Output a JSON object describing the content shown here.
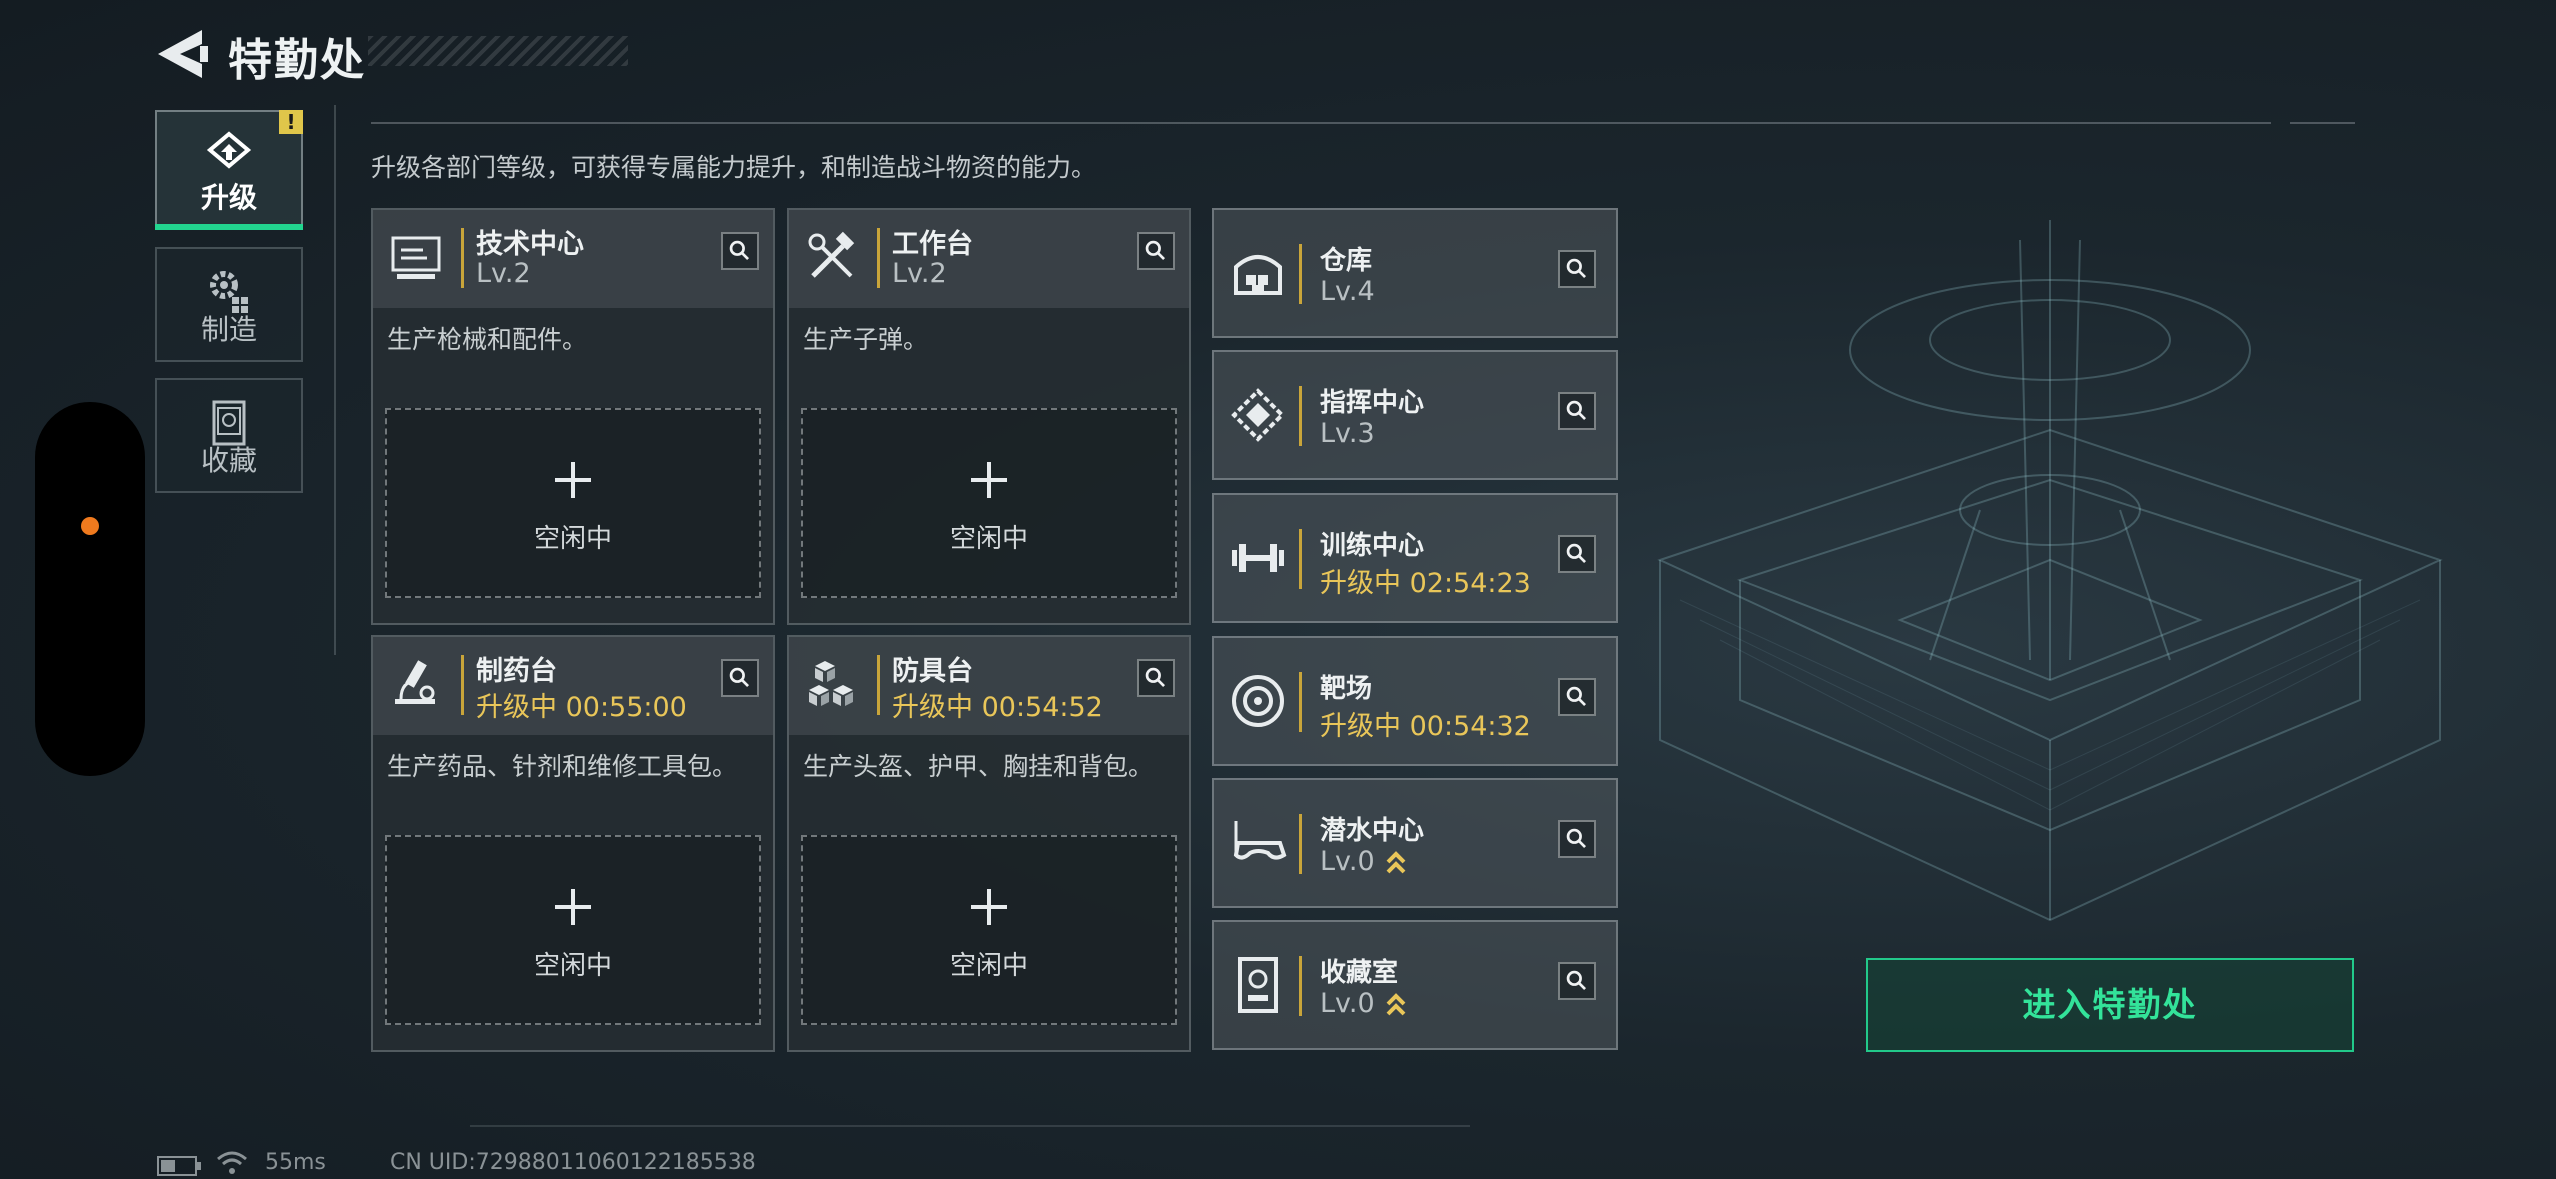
{
  "header": {
    "title": "特勤处"
  },
  "sidebar": {
    "tabs": [
      {
        "label": "升级",
        "icon": "upgrade-icon",
        "active": true,
        "alert": "!"
      },
      {
        "label": "制造",
        "icon": "gears-icon",
        "active": false
      },
      {
        "label": "收藏",
        "icon": "collection-icon",
        "active": false
      }
    ]
  },
  "description": "升级各部门等级，可获得专属能力提升，和制造战斗物资的能力。",
  "facilities": [
    {
      "name": "技术中心",
      "level": "Lv.2",
      "desc": "生产枪械和配件。",
      "slot": "空闲中",
      "icon": "tech-monitor-icon"
    },
    {
      "name": "工作台",
      "level": "Lv.2",
      "desc": "生产子弹。",
      "slot": "空闲中",
      "icon": "tools-icon"
    },
    {
      "name": "制药台",
      "level": "升级中 00:55:00",
      "desc": "生产药品、针剂和维修工具包。",
      "slot": "空闲中",
      "icon": "microscope-icon"
    },
    {
      "name": "防具台",
      "level": "升级中 00:54:52",
      "desc": "生产头盔、护甲、胸挂和背包。",
      "slot": "空闲中",
      "icon": "armor-blocks-icon"
    }
  ],
  "departments": [
    {
      "name": "仓库",
      "level": "Lv.4",
      "icon": "warehouse-icon"
    },
    {
      "name": "指挥中心",
      "level": "Lv.3",
      "icon": "command-chip-icon"
    },
    {
      "name": "训练中心",
      "level": "升级中 02:54:23",
      "icon": "dumbbell-icon"
    },
    {
      "name": "靶场",
      "level": "升级中 00:54:32",
      "icon": "target-icon"
    },
    {
      "name": "潜水中心",
      "level": "Lv.0",
      "icon": "diving-mask-icon"
    },
    {
      "name": "收藏室",
      "level": "Lv.0",
      "icon": "display-case-icon"
    }
  ],
  "enter_button": "进入特勤处",
  "status": {
    "ping": "55ms",
    "uid": "CN UID:7298801106012218553​8"
  },
  "colors": {
    "accent_green": "#22d58f",
    "upgrading_gold": "#e9c659",
    "alert_yellow": "#e0c64a"
  }
}
